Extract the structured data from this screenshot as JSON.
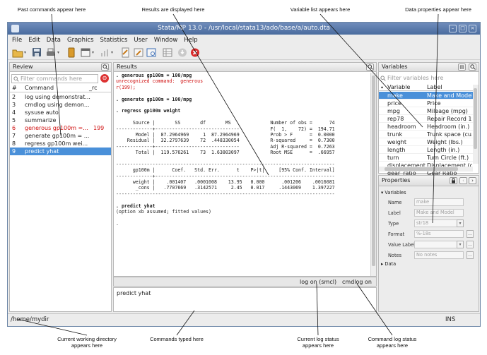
{
  "window": {
    "title": "Stata/MP 13.0 - /usr/local/stata13/ado/base/a/auto.dta",
    "controls": [
      "–",
      "□",
      "×"
    ]
  },
  "menu": [
    "File",
    "Edit",
    "Data",
    "Graphics",
    "Statistics",
    "User",
    "Window",
    "Help"
  ],
  "toolbar": {
    "icons": [
      "open-icon",
      "save-icon",
      "print-icon",
      "log-icon",
      "viewer-icon",
      "graph-icon",
      "do-file-editor-icon",
      "data-editor-icon",
      "data-browser-icon",
      "variables-manager-icon",
      "more-icon",
      "break-icon"
    ],
    "drop_glyph": "▾"
  },
  "annotations": {
    "past_commands": "Past commands appear here",
    "results": "Results are displayed here",
    "variable_list": "Variable list appears here",
    "data_properties": "Data properties appear here",
    "working_dir": [
      "Current working directory",
      "appears here"
    ],
    "commands_typed": "Commands typed here",
    "log_status": [
      "Current log status",
      "appears here"
    ],
    "command_log_status": [
      "Command log status",
      "appears here"
    ]
  },
  "review": {
    "title": "Review",
    "filter_placeholder": "Filter commands here",
    "columns": {
      "num": "#",
      "command": "Command",
      "rc": "_rc"
    },
    "rows": [
      {
        "num": "2",
        "command": "log using demonstrat...",
        "rc": "",
        "error": false,
        "selected": false
      },
      {
        "num": "3",
        "command": "cmdlog using demon...",
        "rc": "",
        "error": false,
        "selected": false
      },
      {
        "num": "4",
        "command": "sysuse auto",
        "rc": "",
        "error": false,
        "selected": false
      },
      {
        "num": "5",
        "command": "summarize",
        "rc": "",
        "error": false,
        "selected": false
      },
      {
        "num": "6",
        "command": "generous gp100m =...",
        "rc": "199",
        "error": true,
        "selected": false
      },
      {
        "num": "7",
        "command": "generate gp100m = ...",
        "rc": "",
        "error": false,
        "selected": false
      },
      {
        "num": "8",
        "command": "regress gp100m wei...",
        "rc": "",
        "error": false,
        "selected": false
      },
      {
        "num": "9",
        "command": "predict yhat",
        "rc": "",
        "error": false,
        "selected": true
      }
    ]
  },
  "results": {
    "title": "Results",
    "lines": [
      {
        "text": ". generous gp100m = 100/mpg",
        "style": "bold"
      },
      {
        "text": "unrecognized command:  generous",
        "style": "red"
      },
      {
        "text": "r(199);",
        "style": "red"
      },
      {
        "text": "",
        "style": ""
      },
      {
        "text": ". generate gp100m = 100/mpg",
        "style": "bold"
      },
      {
        "text": "",
        "style": ""
      },
      {
        "text": ". regress gp100m weight",
        "style": "bold"
      },
      {
        "text": "",
        "style": ""
      },
      {
        "text": "      Source |       SS       df       MS              Number of obs =      74",
        "style": ""
      },
      {
        "text": "-------------+------------------------------           F(  1,    72) =  194.71",
        "style": ""
      },
      {
        "text": "       Model |  87.2964969     1  87.2964969           Prob > F      =  0.0000",
        "style": ""
      },
      {
        "text": "    Residual |  32.2797639    72  .448330054           R-squared     =  0.7300",
        "style": ""
      },
      {
        "text": "-------------+------------------------------           Adj R-squared =  0.7263",
        "style": ""
      },
      {
        "text": "       Total |  119.576261    73  1.63803097           Root MSE      =  .66957",
        "style": ""
      },
      {
        "text": "",
        "style": ""
      },
      {
        "text": "------------------------------------------------------------------------------",
        "style": ""
      },
      {
        "text": "      gp100m |      Coef.   Std. Err.      t    P>|t|     [95% Conf. Interval]",
        "style": ""
      },
      {
        "text": "-------------+----------------------------------------------------------------",
        "style": ""
      },
      {
        "text": "      weight |    .001407   .0001008    13.95   0.000      .001206    .0016081",
        "style": ""
      },
      {
        "text": "       _cons |   .7707669   .3142571     2.45   0.017     .1443069    1.397227",
        "style": ""
      },
      {
        "text": "------------------------------------------------------------------------------",
        "style": ""
      },
      {
        "text": "",
        "style": ""
      },
      {
        "text": ". predict yhat",
        "style": "bold"
      },
      {
        "text": "(option xb assumed; fitted values)",
        "style": ""
      },
      {
        "text": "",
        "style": ""
      },
      {
        "text": ".",
        "style": ""
      }
    ]
  },
  "status_strip": {
    "log": "log on (smcl)",
    "cmdlog": "cmdlog on"
  },
  "command": {
    "text": "predict yhat"
  },
  "variables": {
    "title": "Variables",
    "filter_placeholder": "Filter variables here",
    "columns": {
      "name": "Variable",
      "label": "Label"
    },
    "rows": [
      {
        "name": "make",
        "label": "Make and Model",
        "selected": true
      },
      {
        "name": "price",
        "label": "Price",
        "selected": false
      },
      {
        "name": "mpg",
        "label": "Mileage (mpg)",
        "selected": false
      },
      {
        "name": "rep78",
        "label": "Repair Record 19",
        "selected": false
      },
      {
        "name": "headroom",
        "label": "Headroom (in.)",
        "selected": false
      },
      {
        "name": "trunk",
        "label": "Trunk space (cu.",
        "selected": false
      },
      {
        "name": "weight",
        "label": "Weight (lbs.)",
        "selected": false
      },
      {
        "name": "length",
        "label": "Length (in.)",
        "selected": false
      },
      {
        "name": "turn",
        "label": "Turn Circle (ft.)",
        "selected": false
      },
      {
        "name": "displacement",
        "label": "Displacement (cu",
        "selected": false
      },
      {
        "name": "gear_ratio",
        "label": "Gear Ratio",
        "selected": false
      },
      {
        "name": "foreign",
        "label": "Car type",
        "selected": false
      }
    ]
  },
  "properties": {
    "title": "Properties",
    "section_variables": "Variables",
    "section_data": "Data",
    "fields": [
      {
        "label": "Name",
        "value": "make"
      },
      {
        "label": "Label",
        "value": "Make and Model"
      },
      {
        "label": "Type",
        "value": "str18"
      },
      {
        "label": "Format",
        "value": "%-18s"
      },
      {
        "label": "Value Label",
        "value": ""
      },
      {
        "label": "Notes",
        "value": "No notes"
      }
    ]
  },
  "statusbar": {
    "cwd": "/home/mydir",
    "mode": "INS"
  },
  "colors": {
    "selection": "#4a90d9",
    "error": "#d01010",
    "title_bar": "#5878a8"
  }
}
